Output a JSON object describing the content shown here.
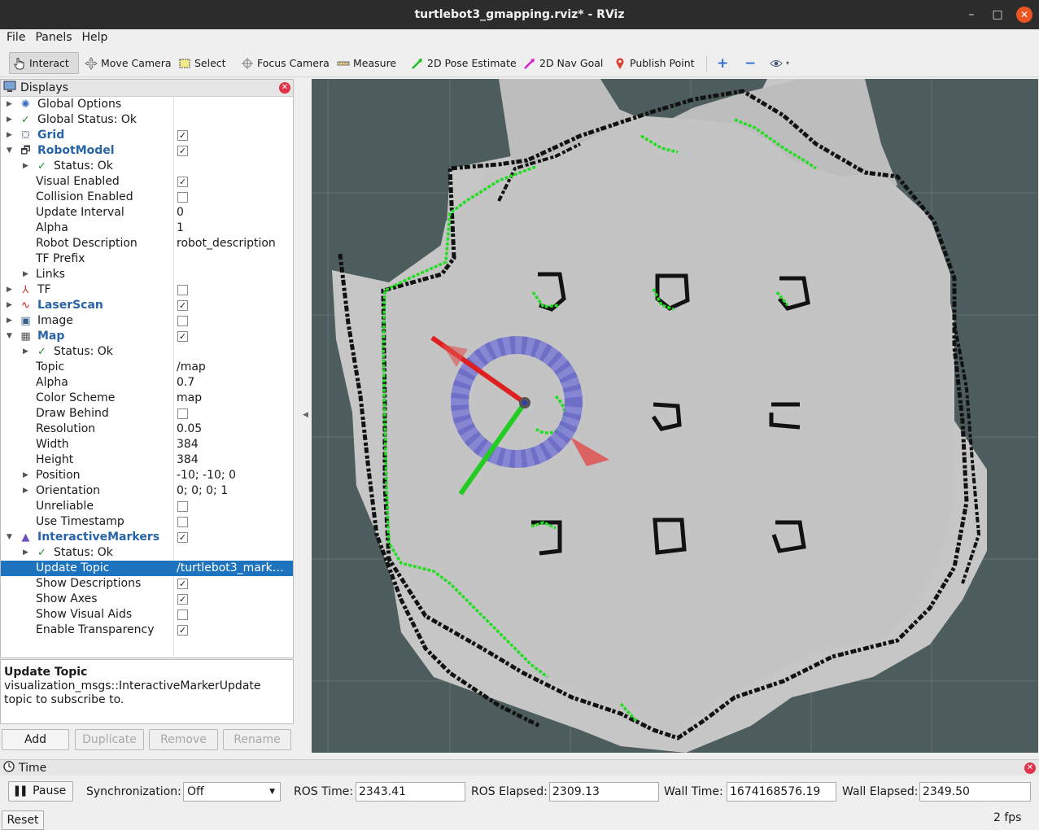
{
  "window": {
    "title": "turtlebot3_gmapping.rviz* - RViz",
    "minimize": "–",
    "maximize": "□",
    "close": "✕"
  },
  "menu": [
    "File",
    "Panels",
    "Help"
  ],
  "toolbar": {
    "interact": "Interact",
    "move_camera": "Move Camera",
    "select": "Select",
    "focus_camera": "Focus Camera",
    "measure": "Measure",
    "pose_estimate": "2D Pose Estimate",
    "nav_goal": "2D Nav Goal",
    "publish_point": "Publish Point",
    "add_icon": "+",
    "remove_icon": "−"
  },
  "displays": {
    "title": "Displays",
    "rows": [
      {
        "label": "Global Options",
        "icon": "gear-icon"
      },
      {
        "label": "Global Status: Ok",
        "icon": "check-icon"
      },
      {
        "label": "Grid",
        "icon": "grid-icon",
        "checked": true
      },
      {
        "label": "RobotModel",
        "icon": "robot-icon",
        "checked": true
      },
      {
        "label": "Status: Ok",
        "icon": "check-icon"
      },
      {
        "label": "Visual Enabled",
        "checked": true
      },
      {
        "label": "Collision Enabled",
        "checked": false
      },
      {
        "label": "Update Interval",
        "value": "0"
      },
      {
        "label": "Alpha",
        "value": "1"
      },
      {
        "label": "Robot Description",
        "value": "robot_description"
      },
      {
        "label": "TF Prefix",
        "value": ""
      },
      {
        "label": "Links"
      },
      {
        "label": "TF",
        "icon": "axes-icon",
        "checked": false
      },
      {
        "label": "LaserScan",
        "icon": "laser-icon",
        "checked": true
      },
      {
        "label": "Image",
        "icon": "image-icon",
        "checked": false
      },
      {
        "label": "Map",
        "icon": "map-icon",
        "checked": true
      },
      {
        "label": "Status: Ok",
        "icon": "check-icon"
      },
      {
        "label": "Topic",
        "value": "/map"
      },
      {
        "label": "Alpha",
        "value": "0.7"
      },
      {
        "label": "Color Scheme",
        "value": "map"
      },
      {
        "label": "Draw Behind",
        "checked": false
      },
      {
        "label": "Resolution",
        "value": "0.05"
      },
      {
        "label": "Width",
        "value": "384"
      },
      {
        "label": "Height",
        "value": "384"
      },
      {
        "label": "Position",
        "value": "-10; -10; 0"
      },
      {
        "label": "Orientation",
        "value": "0; 0; 0; 1"
      },
      {
        "label": "Unreliable",
        "checked": false
      },
      {
        "label": "Use Timestamp",
        "checked": false
      },
      {
        "label": "InteractiveMarkers",
        "icon": "marker-icon",
        "checked": true
      },
      {
        "label": "Status: Ok",
        "icon": "check-icon"
      },
      {
        "label": "Update Topic",
        "value": "/turtlebot3_mark…"
      },
      {
        "label": "Show Descriptions",
        "checked": true
      },
      {
        "label": "Show Axes",
        "checked": true
      },
      {
        "label": "Show Visual Aids",
        "checked": false
      },
      {
        "label": "Enable Transparency",
        "checked": true
      }
    ]
  },
  "description": {
    "title": "Update Topic",
    "text": "visualization_msgs::InteractiveMarkerUpdate topic to subscribe to."
  },
  "buttons": {
    "add": "Add",
    "duplicate": "Duplicate",
    "remove": "Remove",
    "rename": "Rename"
  },
  "time": {
    "title": "Time",
    "pause": "Pause",
    "sync_label": "Synchronization:",
    "sync_value": "Off",
    "ros_time_label": "ROS Time:",
    "ros_time": "2343.41",
    "ros_elapsed_label": "ROS Elapsed:",
    "ros_elapsed": "2309.13",
    "wall_time_label": "Wall Time:",
    "wall_time": "1674168576.19",
    "wall_elapsed_label": "Wall Elapsed:",
    "wall_elapsed": "2349.50",
    "reset": "Reset",
    "fps": "2 fps"
  },
  "colors": {
    "selection": "#1e73be",
    "map_free": "#c5c5c5",
    "map_unknown": "#4d5d5d",
    "map_occupied": "#111111",
    "laser": "#22dd22",
    "marker_ring": "#7b7bd6",
    "x_axis": "#e02020",
    "y_axis": "#22cc22"
  }
}
